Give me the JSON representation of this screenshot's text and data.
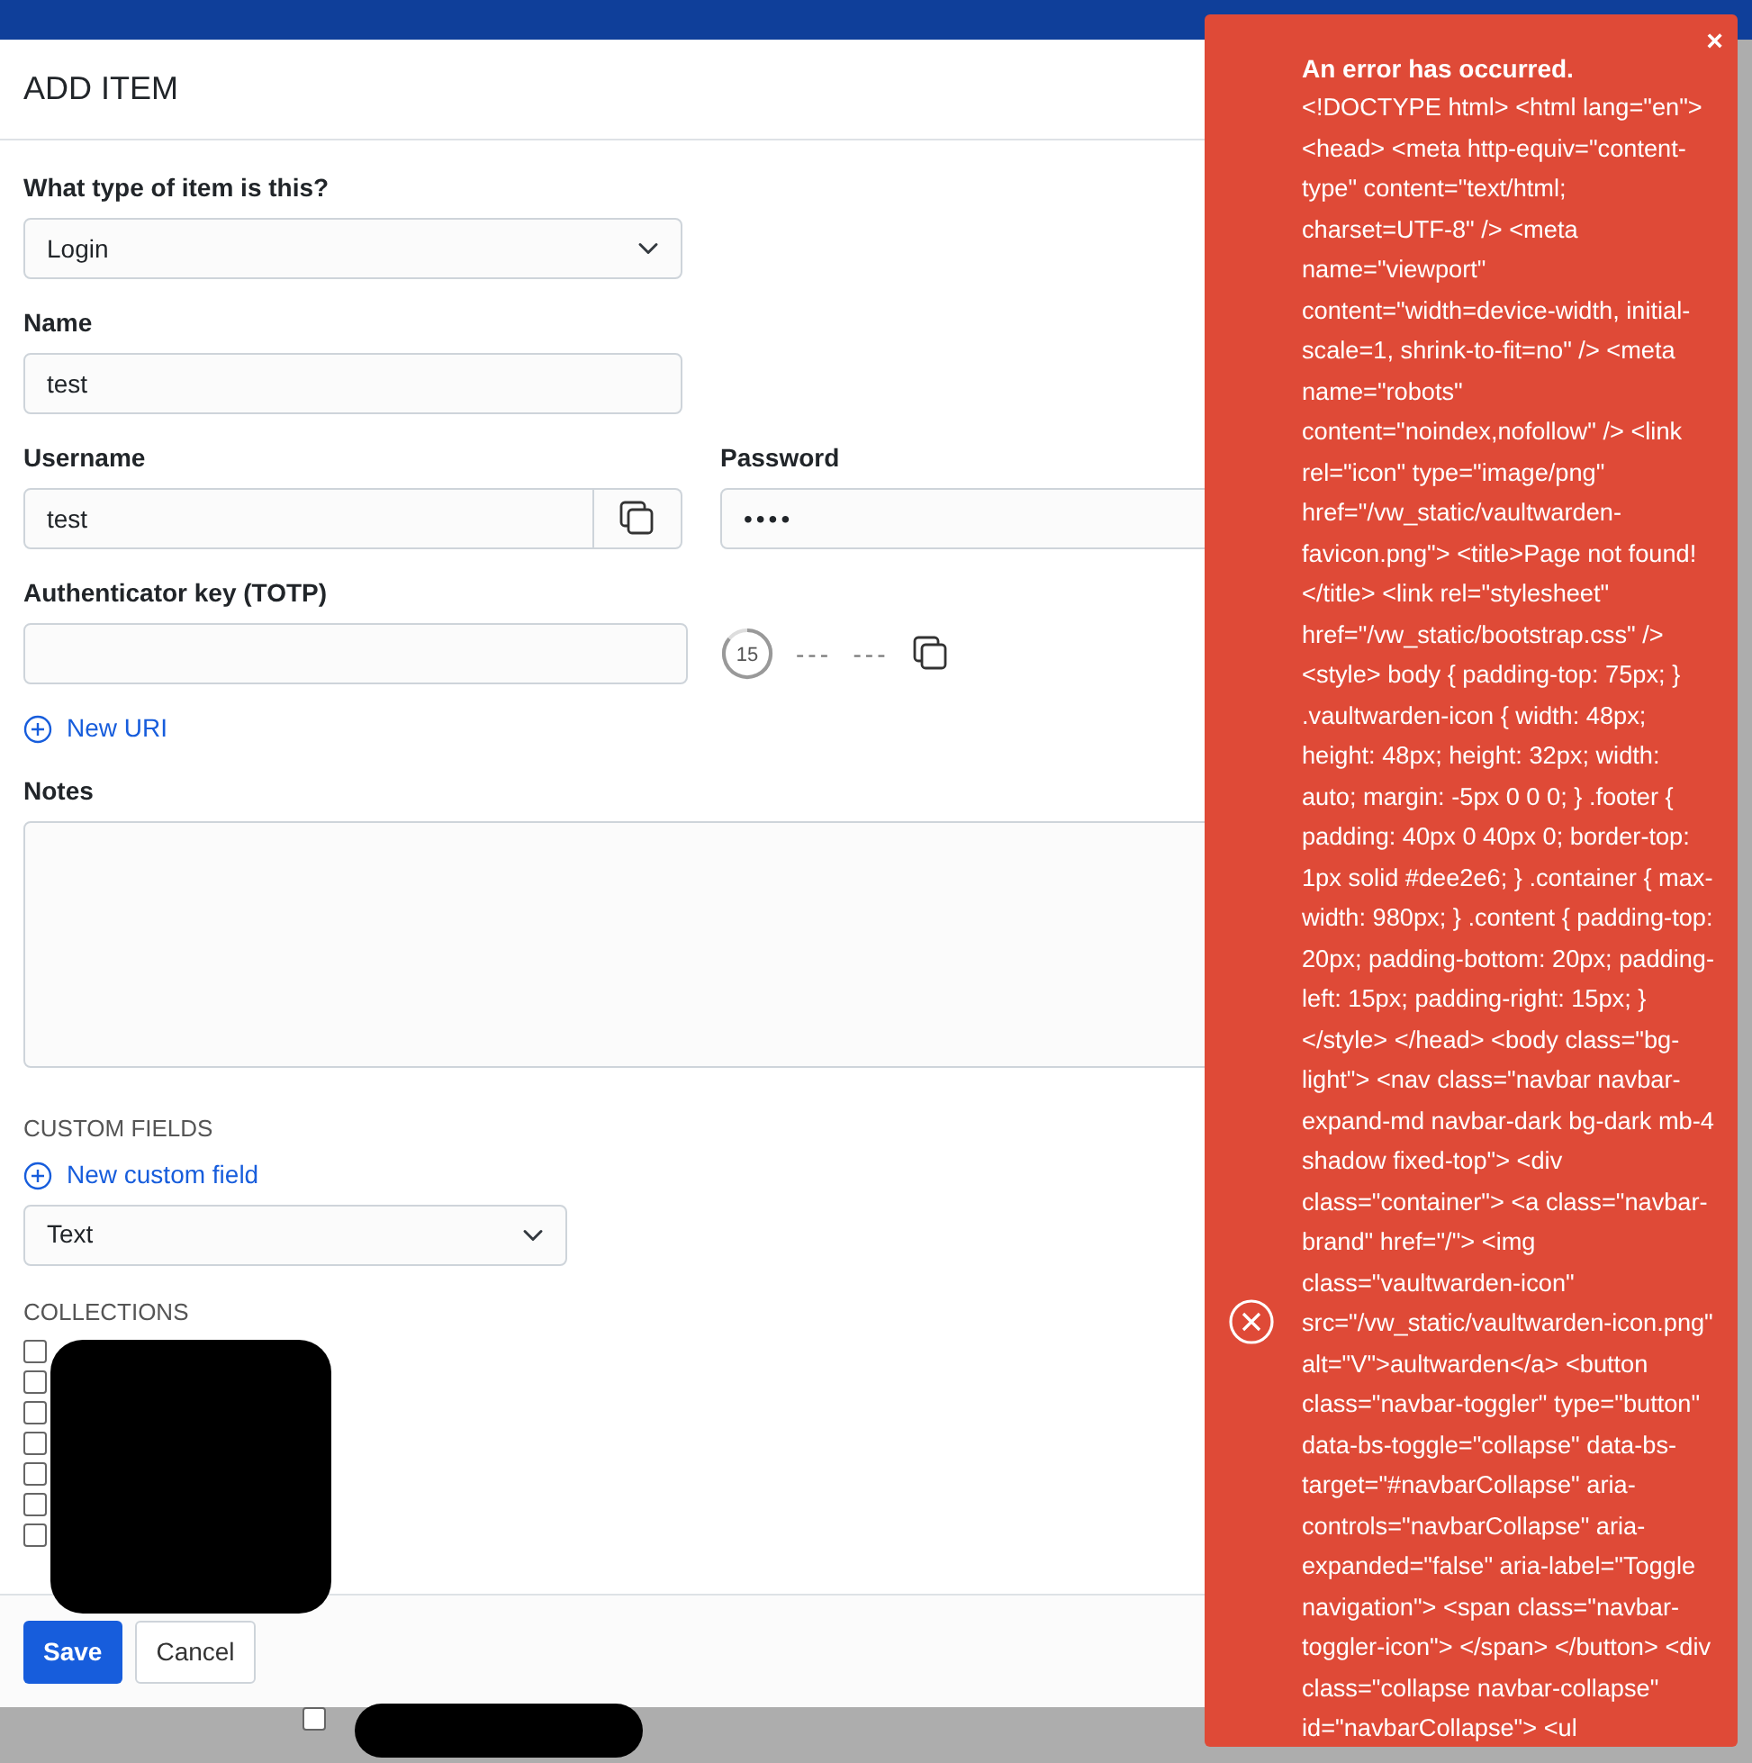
{
  "dialog": {
    "title": "ADD ITEM",
    "type_field": {
      "label": "What type of item is this?",
      "value": "Login"
    },
    "name_field": {
      "label": "Name",
      "value": "test"
    },
    "username_field": {
      "label": "Username",
      "value": "test"
    },
    "password_field": {
      "label": "Password",
      "value": "••••"
    },
    "totp_field": {
      "label": "Authenticator key (TOTP)",
      "countdown": "15",
      "code": "---  ---"
    },
    "new_uri_link": "New URI",
    "notes_field": {
      "label": "Notes"
    },
    "custom_fields": {
      "heading": "CUSTOM FIELDS",
      "add_link": "New custom field",
      "type_value": "Text"
    },
    "collections": {
      "heading": "COLLECTIONS",
      "items": [
        {
          "checked": false
        },
        {
          "checked": false
        },
        {
          "checked": false
        },
        {
          "checked": false
        },
        {
          "checked": false
        },
        {
          "checked": false
        },
        {
          "checked": false
        }
      ]
    },
    "buttons": [
      {
        "label": "Save",
        "kind": "primary"
      },
      {
        "label": "Cancel",
        "kind": "secondary"
      }
    ]
  },
  "backdrop_checkbox": {
    "checked": false
  },
  "error_toast": {
    "close": "×",
    "title": "An error has occurred.",
    "message": "<!DOCTYPE html> <html lang=\"en\"> <head> <meta http-equiv=\"content-type\" content=\"text/html; charset=UTF-8\" /> <meta name=\"viewport\" content=\"width=device-width, initial-scale=1, shrink-to-fit=no\" /> <meta name=\"robots\" content=\"noindex,nofollow\" /> <link rel=\"icon\" type=\"image/png\" href=\"/vw_static/vaultwarden-favicon.png\"> <title>Page not found!</title> <link rel=\"stylesheet\" href=\"/vw_static/bootstrap.css\" /> <style> body { padding-top: 75px; } .vaultwarden-icon { width: 48px; height: 48px; height: 32px; width: auto; margin: -5px 0 0 0; } .footer { padding: 40px 0 40px 0; border-top: 1px solid #dee2e6; } .container { max-width: 980px; } .content { padding-top: 20px; padding-bottom: 20px; padding-left: 15px; padding-right: 15px; } </style> </head> <body class=\"bg-light\"> <nav class=\"navbar navbar-expand-md navbar-dark bg-dark mb-4 shadow fixed-top\"> <div class=\"container\"> <a class=\"navbar-brand\" href=\"/\"> <img class=\"vaultwarden-icon\" src=\"/vw_static/vaultwarden-icon.png\" alt=\"V\">aultwarden</a> <button class=\"navbar-toggler\" type=\"button\" data-bs-toggle=\"collapse\" data-bs-target=\"#navbarCollapse\" aria-controls=\"navbarCollapse\" aria-expanded=\"false\" aria-label=\"Toggle navigation\"> <span class=\"navbar-toggler-icon\"> </span> </button> <div class=\"collapse navbar-collapse\" id=\"navbarCollapse\"> <ul"
  }
}
